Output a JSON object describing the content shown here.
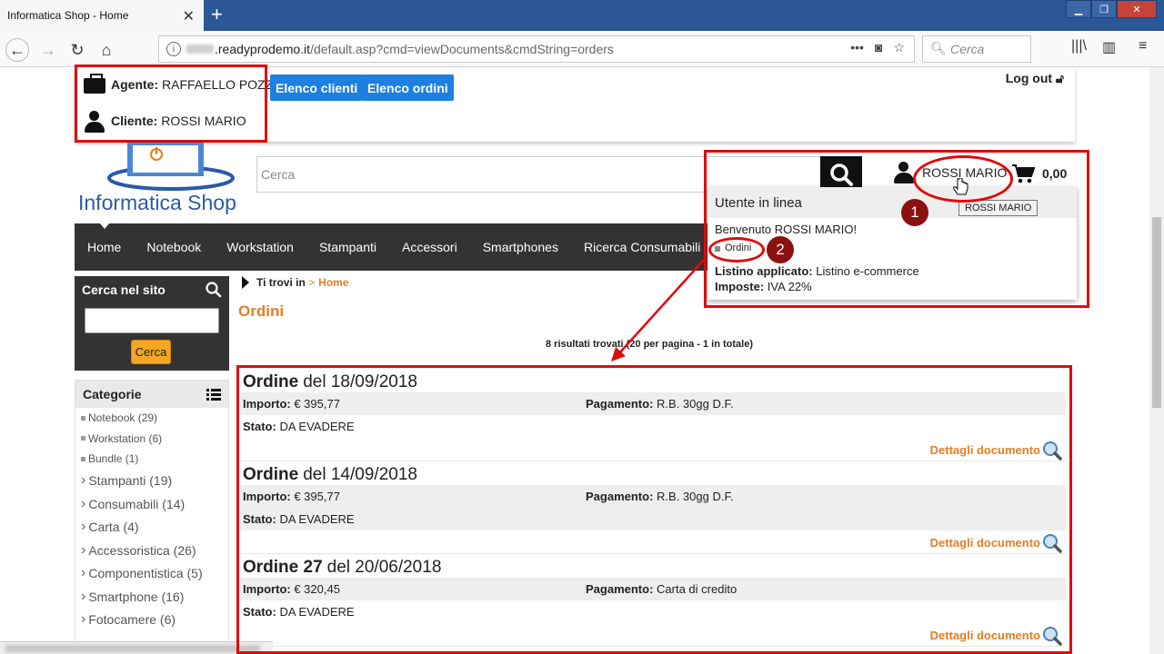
{
  "browser": {
    "tab_title": "Informatica Shop - Home",
    "url_domain": ".readyprodemo.it",
    "url_path": "/default.asp?cmd=viewDocuments&cmdString=orders",
    "search_placeholder": "Cerca"
  },
  "agent_bar": {
    "agent_label": "Agente:",
    "agent_name": "RAFFAELLO POZZI",
    "client_label": "Cliente:",
    "client_name": "ROSSI MARIO",
    "btn_clients": "Elenco clienti",
    "btn_orders": "Elenco ordini",
    "logout": "Log out"
  },
  "header": {
    "logo_text": "Informatica Shop",
    "search_placeholder": "Cerca",
    "user_name": "ROSSI MARIO",
    "cart_total": "0,00"
  },
  "menu": {
    "items": [
      "Home",
      "Notebook",
      "Workstation",
      "Stampanti",
      "Accessori",
      "Smartphones",
      "Ricerca Consumabili"
    ]
  },
  "user_popup": {
    "title": "Utente in linea",
    "welcome": "Benvenuto ROSSI MARIO!",
    "orders_link": "Ordini",
    "listino_label": "Listino applicato:",
    "listino_value": "Listino e-commerce",
    "imposte_label": "Imposte:",
    "imposte_value": "IVA 22%",
    "tooltip": "ROSSI MARIO"
  },
  "sidebar": {
    "search_title": "Cerca nel sito",
    "search_button": "Cerca",
    "categories_title": "Categorie",
    "categories": [
      {
        "label": "Notebook (29)"
      },
      {
        "label": "Workstation (6)"
      },
      {
        "label": "Bundle (1)"
      },
      {
        "label": "Stampanti (19)"
      },
      {
        "label": "Consumabili (14)"
      },
      {
        "label": "Carta (4)"
      },
      {
        "label": "Accessoristica (26)"
      },
      {
        "label": "Componentistica (5)"
      },
      {
        "label": "Smartphone (16)"
      },
      {
        "label": "Fotocamere (6)"
      }
    ]
  },
  "main": {
    "breadcrumb_prefix": "Ti trovi in",
    "breadcrumb_sep": ">",
    "breadcrumb_home": "Home",
    "title": "Ordini",
    "results": "8 risultati trovati (20 per pagina - 1 in totale)",
    "orders": [
      {
        "title_bold": "Ordine",
        "title_rest": "del 18/09/2018",
        "importo_label": "Importo:",
        "importo": "€ 395,77",
        "pagamento_label": "Pagamento:",
        "pagamento": "R.B. 30gg D.F.",
        "stato_label": "Stato:",
        "stato": "DA EVADERE",
        "detail": "Dettagli documento"
      },
      {
        "title_bold": "Ordine",
        "title_rest": "del 14/09/2018",
        "importo_label": "Importo:",
        "importo": "€ 395,77",
        "pagamento_label": "Pagamento:",
        "pagamento": "R.B. 30gg D.F.",
        "stato_label": "Stato:",
        "stato": "DA EVADERE",
        "detail": "Dettagli documento"
      },
      {
        "title_bold": "Ordine 27",
        "title_rest": "del 20/06/2018",
        "importo_label": "Importo:",
        "importo": "€ 320,45",
        "pagamento_label": "Pagamento:",
        "pagamento": "Carta di credito",
        "stato_label": "Stato:",
        "stato": "DA EVADERE",
        "detail": "Dettagli documento"
      }
    ]
  },
  "annotations": {
    "marker_1": "1",
    "marker_2": "2",
    "highlight_color": "#e10a0a"
  }
}
